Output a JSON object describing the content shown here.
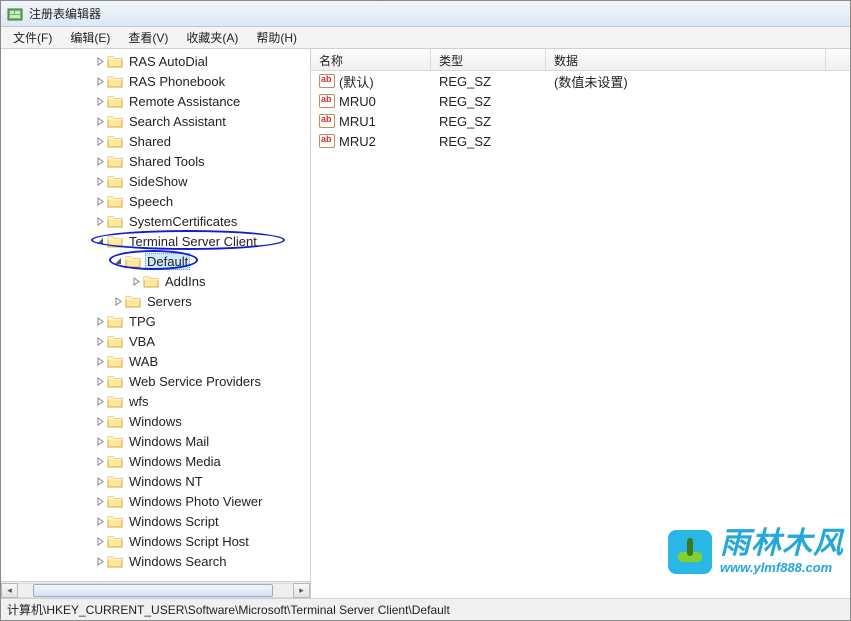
{
  "title": "注册表编辑器",
  "menus": {
    "file": "文件(F)",
    "edit": "编辑(E)",
    "view": "查看(V)",
    "favorites": "收藏夹(A)",
    "help": "帮助(H)"
  },
  "tree": {
    "items": [
      {
        "label": "RAS AutoDial",
        "indent": 4,
        "expandable": true
      },
      {
        "label": "RAS Phonebook",
        "indent": 4,
        "expandable": true
      },
      {
        "label": "Remote Assistance",
        "indent": 4,
        "expandable": true
      },
      {
        "label": "Search Assistant",
        "indent": 4,
        "expandable": true
      },
      {
        "label": "Shared",
        "indent": 4,
        "expandable": true
      },
      {
        "label": "Shared Tools",
        "indent": 4,
        "expandable": true
      },
      {
        "label": "SideShow",
        "indent": 4,
        "expandable": true
      },
      {
        "label": "Speech",
        "indent": 4,
        "expandable": true
      },
      {
        "label": "SystemCertificates",
        "indent": 4,
        "expandable": true
      },
      {
        "label": "Terminal Server Client",
        "indent": 4,
        "expandable": true,
        "expanded": true,
        "circled": true
      },
      {
        "label": "Default",
        "indent": 5,
        "expandable": true,
        "expanded": true,
        "circled": true,
        "selected": true
      },
      {
        "label": "AddIns",
        "indent": 6,
        "expandable": true
      },
      {
        "label": "Servers",
        "indent": 5,
        "expandable": true
      },
      {
        "label": "TPG",
        "indent": 4,
        "expandable": true
      },
      {
        "label": "VBA",
        "indent": 4,
        "expandable": true
      },
      {
        "label": "WAB",
        "indent": 4,
        "expandable": true
      },
      {
        "label": "Web Service Providers",
        "indent": 4,
        "expandable": true
      },
      {
        "label": "wfs",
        "indent": 4,
        "expandable": true
      },
      {
        "label": "Windows",
        "indent": 4,
        "expandable": true
      },
      {
        "label": "Windows Mail",
        "indent": 4,
        "expandable": true
      },
      {
        "label": "Windows Media",
        "indent": 4,
        "expandable": true
      },
      {
        "label": "Windows NT",
        "indent": 4,
        "expandable": true
      },
      {
        "label": "Windows Photo Viewer",
        "indent": 4,
        "expandable": true
      },
      {
        "label": "Windows Script",
        "indent": 4,
        "expandable": true
      },
      {
        "label": "Windows Script Host",
        "indent": 4,
        "expandable": true
      },
      {
        "label": "Windows Search",
        "indent": 4,
        "expandable": true
      }
    ]
  },
  "columns": {
    "name": "名称",
    "type": "类型",
    "data": "数据"
  },
  "column_widths": {
    "name": 120,
    "type": 115,
    "data": 280
  },
  "values": [
    {
      "name": "(默认)",
      "type": "REG_SZ",
      "data": "(数值未设置)"
    },
    {
      "name": "MRU0",
      "type": "REG_SZ",
      "data": ""
    },
    {
      "name": "MRU1",
      "type": "REG_SZ",
      "data": ""
    },
    {
      "name": "MRU2",
      "type": "REG_SZ",
      "data": ""
    }
  ],
  "statusbar": "计算机\\HKEY_CURRENT_USER\\Software\\Microsoft\\Terminal Server Client\\Default",
  "watermark": {
    "big": "雨林木风",
    "small": "www.ylmf888.com"
  }
}
